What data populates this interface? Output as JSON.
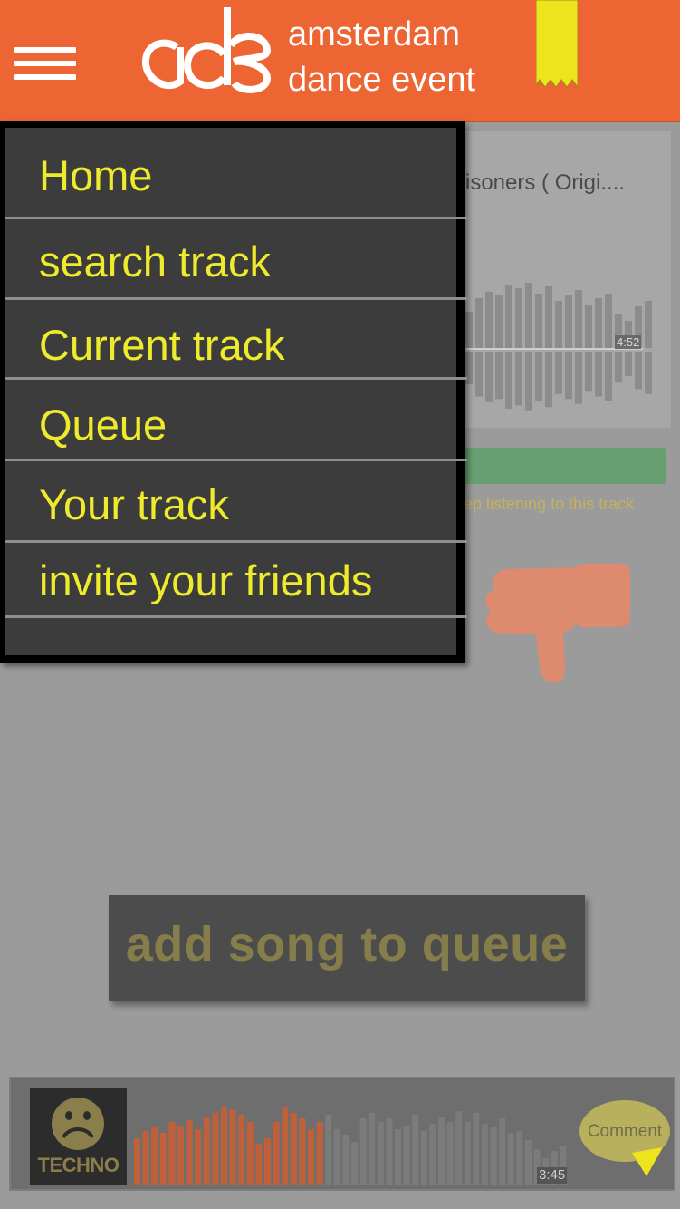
{
  "header": {
    "logo_text": "ade",
    "brand_line1": "amsterdam",
    "brand_line2": "dance event"
  },
  "menu": {
    "items": [
      {
        "label": "Home"
      },
      {
        "label": "search track"
      },
      {
        "label": "Current track"
      },
      {
        "label": "Queue"
      },
      {
        "label": "Your track"
      },
      {
        "label": "invite your friends"
      }
    ]
  },
  "current_track": {
    "title": "risoners ( Origi....",
    "time": "4:52",
    "keep_listening": "ep listening to this track"
  },
  "actions": {
    "add_song": "add song to queue"
  },
  "player": {
    "genre": "TECHNO",
    "time": "3:45",
    "comment": "Comment"
  },
  "colors": {
    "header": "#ec6532",
    "menu_bg": "#3c3c3c",
    "menu_text": "#eeea2c",
    "ribbon": "#eee41e"
  }
}
